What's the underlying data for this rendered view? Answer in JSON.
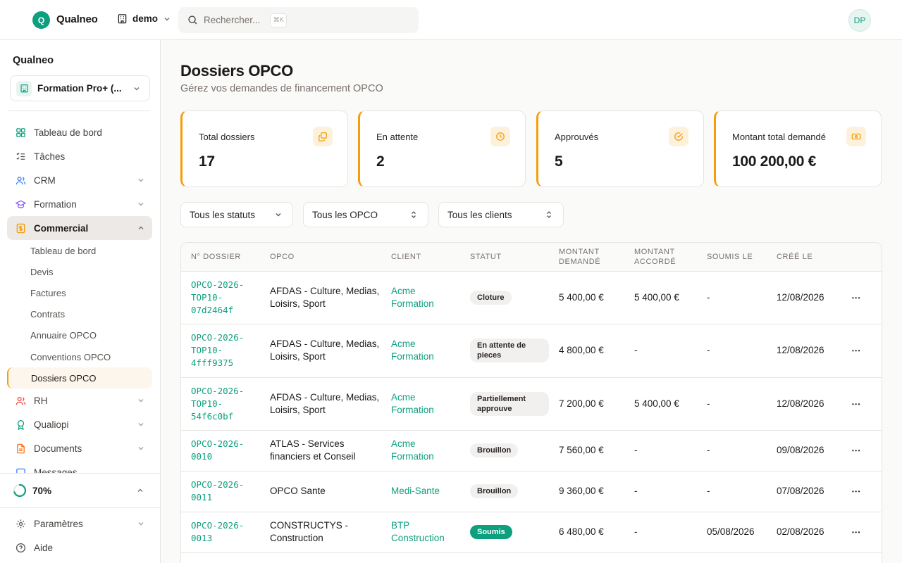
{
  "header": {
    "logo_letter": "Q",
    "app_name": "Qualneo",
    "workspace": "demo",
    "search_placeholder": "Rechercher...",
    "search_shortcut": "⌘K",
    "avatar_initials": "DP"
  },
  "sidebar": {
    "org_title": "Qualneo",
    "org_select": "Formation Pro+ (...",
    "nav": [
      {
        "label": "Tableau de bord",
        "icon": "grid-icon"
      },
      {
        "label": "Tâches",
        "icon": "list-check-icon"
      },
      {
        "label": "CRM",
        "icon": "users-icon"
      },
      {
        "label": "Formation",
        "icon": "graduation-cap-icon"
      },
      {
        "label": "Commercial",
        "icon": "receipt-icon"
      }
    ],
    "commercial_sub": [
      "Tableau de bord",
      "Devis",
      "Factures",
      "Contrats",
      "Annuaire OPCO",
      "Conventions OPCO",
      "Dossiers OPCO"
    ],
    "nav_after": [
      {
        "label": "RH",
        "icon": "people-icon"
      },
      {
        "label": "Qualiopi",
        "icon": "award-icon"
      },
      {
        "label": "Documents",
        "icon": "file-icon"
      },
      {
        "label": "Messages",
        "icon": "message-icon"
      }
    ],
    "progress_label": "70%",
    "progress_value": 0.7,
    "footer": [
      {
        "label": "Paramètres",
        "icon": "gear-icon"
      },
      {
        "label": "Aide",
        "icon": "help-icon"
      }
    ]
  },
  "main": {
    "title": "Dossiers OPCO",
    "subtitle": "Gérez vos demandes de financement OPCO",
    "stats": [
      {
        "label": "Total dossiers",
        "value": "17",
        "icon": "copy-icon"
      },
      {
        "label": "En attente",
        "value": "2",
        "icon": "clock-icon"
      },
      {
        "label": "Approuvés",
        "value": "5",
        "icon": "check-circle-icon"
      },
      {
        "label": "Montant total demandé",
        "value": "100 200,00 €",
        "icon": "banknote-icon"
      }
    ],
    "filters": [
      "Tous les statuts",
      "Tous les OPCO",
      "Tous les clients"
    ],
    "table": {
      "columns": [
        "N° DOSSIER",
        "OPCO",
        "CLIENT",
        "STATUT",
        "MONTANT DEMANDÉ",
        "MONTANT ACCORDÉ",
        "SOUMIS LE",
        "CRÉÉ LE"
      ],
      "rows": [
        {
          "ref": "OPCO-2026-TOP10-07d2464f",
          "opco": "AFDAS - Culture, Medias, Loisirs, Sport",
          "client": "Acme Formation",
          "status": "Cloture",
          "requested": "5 400,00 €",
          "granted": "5 400,00 €",
          "submitted": "-",
          "created": "12/08/2026"
        },
        {
          "ref": "OPCO-2026-TOP10-4fff9375",
          "opco": "AFDAS - Culture, Medias, Loisirs, Sport",
          "client": "Acme Formation",
          "status": "En attente de pieces",
          "requested": "4 800,00 €",
          "granted": "-",
          "submitted": "-",
          "created": "12/08/2026"
        },
        {
          "ref": "OPCO-2026-TOP10-54f6c0bf",
          "opco": "AFDAS - Culture, Medias, Loisirs, Sport",
          "client": "Acme Formation",
          "status": "Partiellement approuve",
          "requested": "7 200,00 €",
          "granted": "5 400,00 €",
          "submitted": "-",
          "created": "12/08/2026"
        },
        {
          "ref": "OPCO-2026-0010",
          "opco": "ATLAS - Services financiers et Conseil",
          "client": "Acme Formation",
          "status": "Brouillon",
          "requested": "7 560,00 €",
          "granted": "-",
          "submitted": "-",
          "created": "09/08/2026"
        },
        {
          "ref": "OPCO-2026-0011",
          "opco": "OPCO Sante",
          "client": "Medi-Sante",
          "status": "Brouillon",
          "requested": "9 360,00 €",
          "granted": "-",
          "submitted": "-",
          "created": "07/08/2026"
        },
        {
          "ref": "OPCO-2026-0013",
          "opco": "CONSTRUCTYS - Construction",
          "client": "BTP Construction",
          "status": "Soumis",
          "requested": "6 480,00 €",
          "granted": "-",
          "submitted": "05/08/2026",
          "created": "02/08/2026"
        }
      ]
    }
  },
  "colors": {
    "accent": "#0e9f7f",
    "warning": "#f59e0b",
    "active_bg": "#ede9e6"
  }
}
